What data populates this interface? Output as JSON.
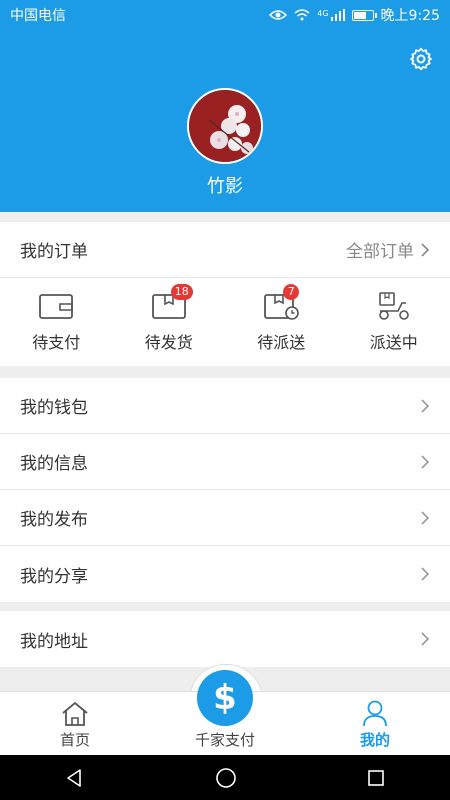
{
  "status_bar": {
    "carrier": "中国电信",
    "network": "4G",
    "time": "晚上9:25",
    "battery_level": 0.8
  },
  "profile": {
    "username": "竹影"
  },
  "orders": {
    "title": "我的订单",
    "all_label": "全部订单",
    "items": [
      {
        "label": "待支付"
      },
      {
        "label": "待发货",
        "badge": "18"
      },
      {
        "label": "待派送",
        "badge": "7"
      },
      {
        "label": "派送中"
      }
    ]
  },
  "menu_group1": [
    {
      "label": "我的钱包"
    },
    {
      "label": "我的信息"
    },
    {
      "label": "我的发布"
    },
    {
      "label": "我的分享"
    }
  ],
  "menu_group2": [
    {
      "label": "我的地址"
    }
  ],
  "tabbar": {
    "home": "首页",
    "pay": "千家支付",
    "pay_symbol": "$",
    "mine": "我的"
  },
  "colors": {
    "primary": "#1c9be6",
    "badge": "#e53935"
  }
}
